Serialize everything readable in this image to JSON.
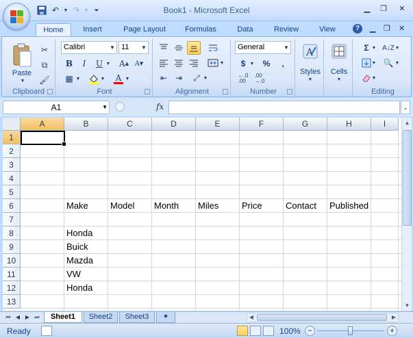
{
  "window": {
    "title": "Book1 - Microsoft Excel"
  },
  "quick_access": [
    {
      "icon": "save-icon"
    },
    {
      "icon": "undo-icon"
    },
    {
      "icon": "redo-icon"
    },
    {
      "icon": "customize-qat-icon"
    }
  ],
  "ribbon_tabs": [
    "Home",
    "Insert",
    "Page Layout",
    "Formulas",
    "Data",
    "Review",
    "View"
  ],
  "active_tab": "Home",
  "ribbon": {
    "clipboard": {
      "label": "Clipboard",
      "paste": "Paste"
    },
    "font": {
      "label": "Font",
      "name": "Calibri",
      "size": "11"
    },
    "alignment": {
      "label": "Alignment"
    },
    "number": {
      "label": "Number",
      "format": "General",
      "currency": "$",
      "percent": "%",
      "comma": ","
    },
    "styles": {
      "label": "Styles"
    },
    "cells": {
      "label": "Cells"
    },
    "editing": {
      "label": "Editing"
    }
  },
  "formula_bar": {
    "name_box": "A1",
    "fx": "fx",
    "content": ""
  },
  "columns": [
    "A",
    "B",
    "C",
    "D",
    "E",
    "F",
    "G",
    "H",
    "I"
  ],
  "rows": [
    "1",
    "2",
    "3",
    "4",
    "5",
    "6",
    "7",
    "8",
    "9",
    "10",
    "11",
    "12",
    "13"
  ],
  "cells": {
    "B6": "Make",
    "C6": "Model",
    "D6": "Month",
    "E6": "Miles",
    "F6": "Price",
    "G6": "Contact",
    "H6": "Published",
    "B8": "Honda",
    "B9": "Buick",
    "B10": "Mazda",
    "B11": "VW",
    "B12": "Honda"
  },
  "active_cell": "A1",
  "sheets": [
    "Sheet1",
    "Sheet2",
    "Sheet3"
  ],
  "active_sheet": "Sheet1",
  "status": {
    "text": "Ready",
    "zoom": "100%"
  }
}
